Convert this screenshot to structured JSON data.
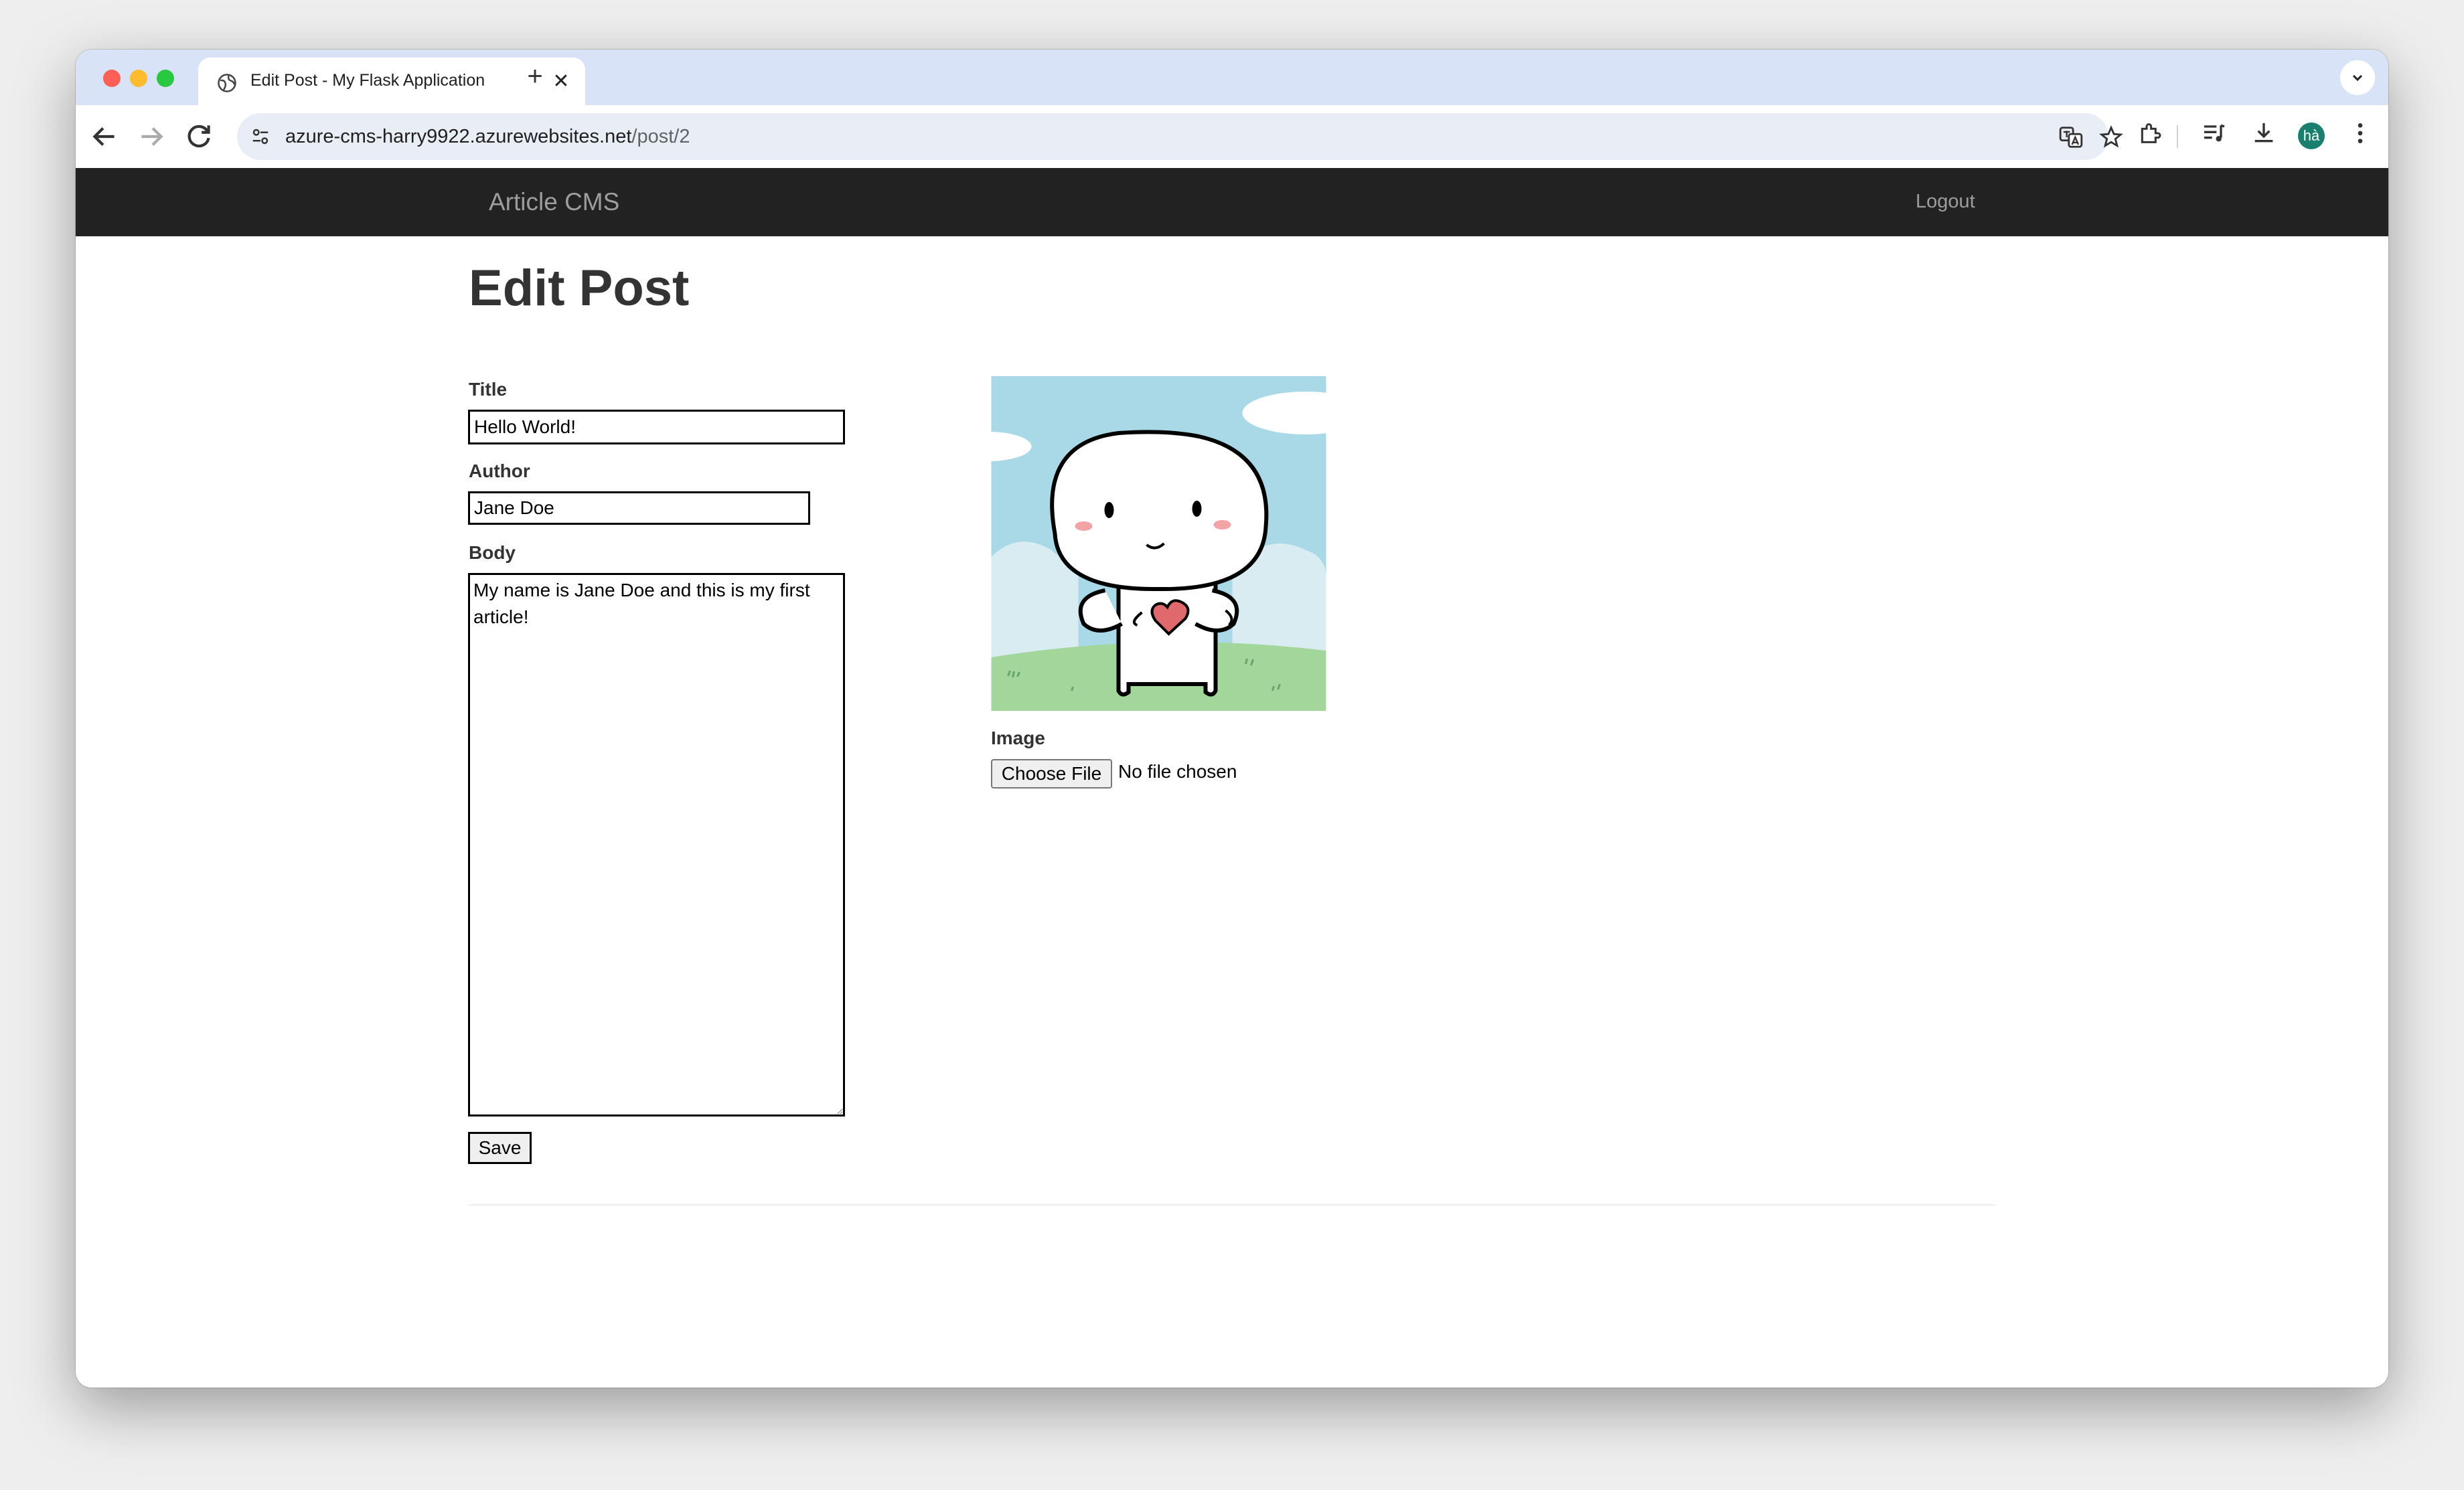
{
  "browser": {
    "tab_title": "Edit Post - My Flask Application",
    "new_tab_symbol": "+",
    "close_symbol": "✕",
    "url_host": "azure-cms-harry9922.azurewebsites.net",
    "url_path": "/post/2",
    "profile_initials": "hà"
  },
  "navbar": {
    "brand": "Article CMS",
    "logout": "Logout",
    "background_color": "#222222",
    "link_color": "#9d9d9d"
  },
  "form": {
    "heading": "Edit Post",
    "title_label": "Title",
    "title_value": "Hello World!",
    "author_label": "Author",
    "author_value": "Jane Doe",
    "body_label": "Body",
    "body_value": "My name is Jane Doe and this is my first article!",
    "save_label": "Save"
  },
  "image_section": {
    "label": "Image",
    "choose_button": "Choose File",
    "no_file_text": "No file chosen",
    "preview_description_icon": "cartoon-character-image"
  }
}
